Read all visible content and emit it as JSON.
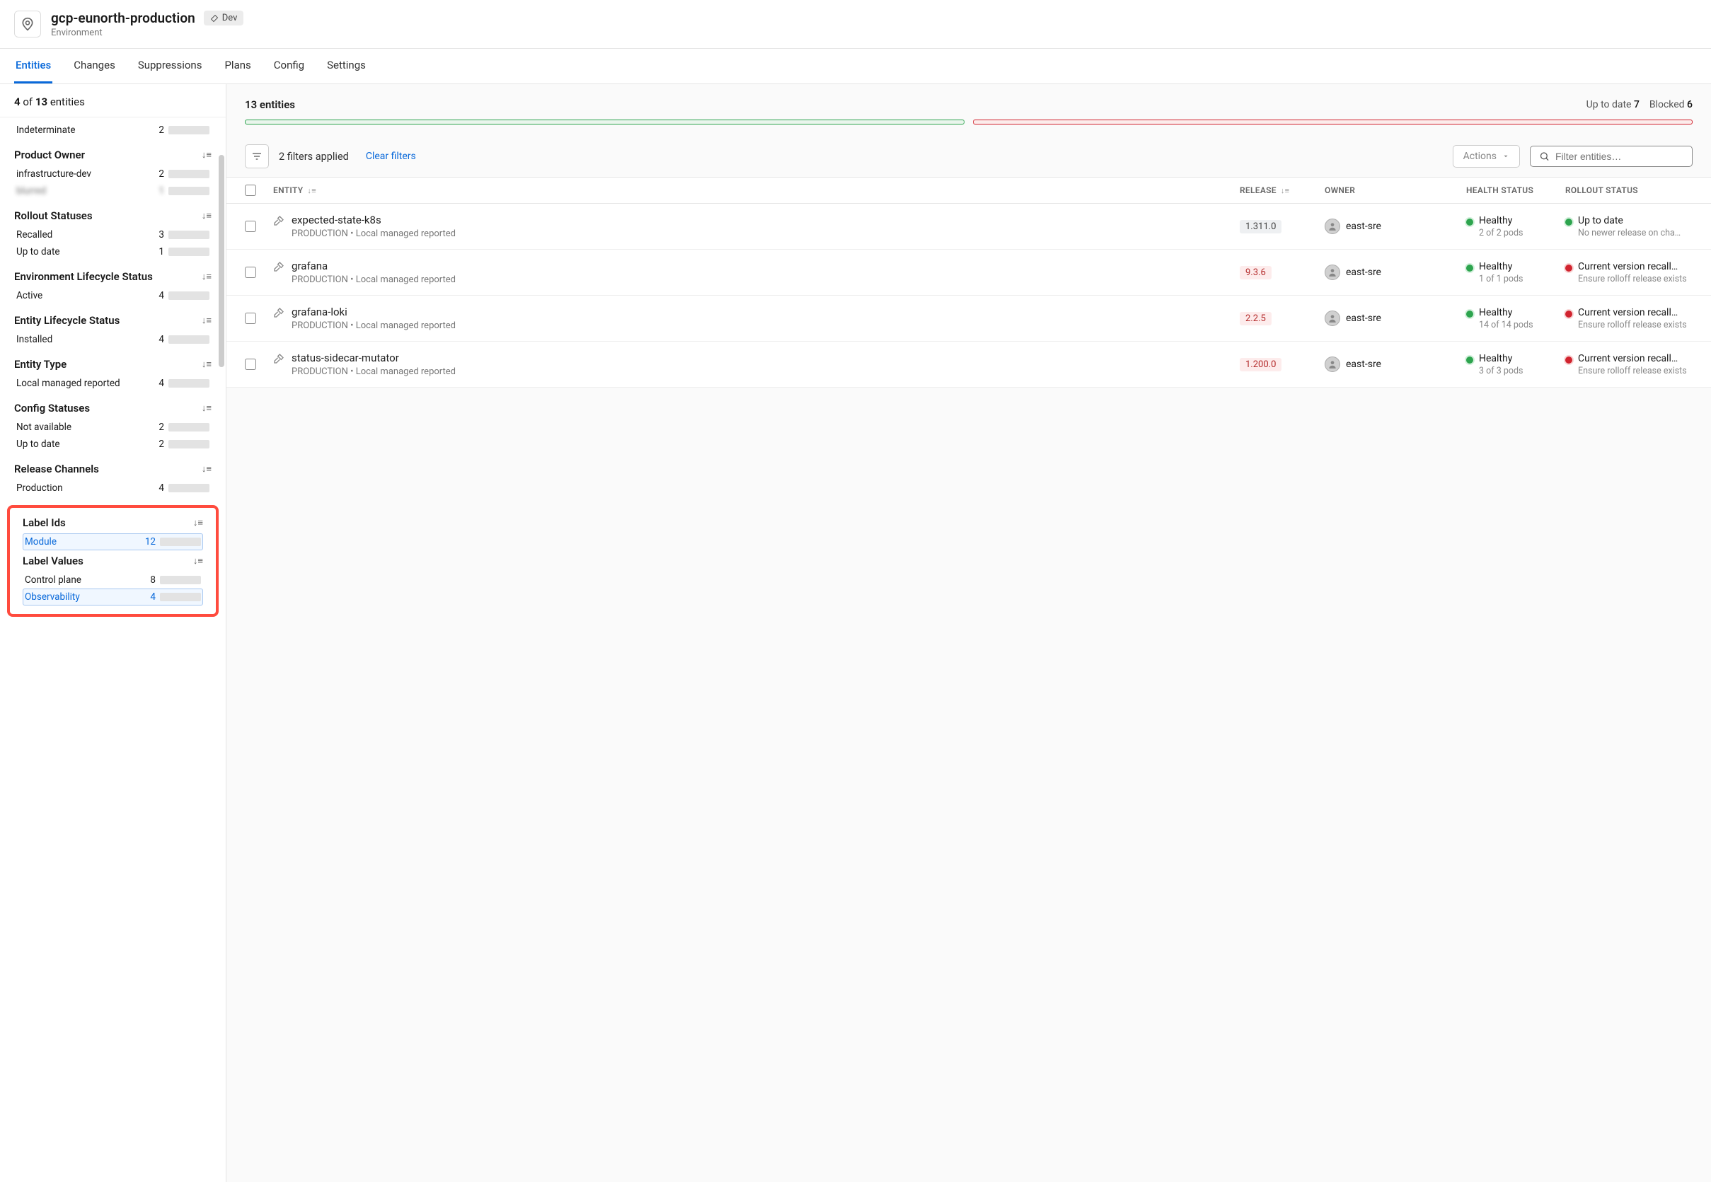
{
  "header": {
    "title": "gcp-eunorth-production",
    "subtitle": "Environment",
    "badge": "Dev"
  },
  "tabs": [
    "Entities",
    "Changes",
    "Suppressions",
    "Plans",
    "Config",
    "Settings"
  ],
  "active_tab": 0,
  "sidebar": {
    "count_shown": "4",
    "count_of": "of",
    "count_total": "13",
    "count_label": "entities",
    "top_row": {
      "label": "Indeterminate",
      "count": 2,
      "pct": 100
    },
    "facets": [
      {
        "title": "Product Owner",
        "rows": [
          {
            "label": "infrastructure-dev",
            "count": 2,
            "pct": 100
          },
          {
            "label": "blurred",
            "count": 1,
            "pct": 55,
            "blur": true
          }
        ]
      },
      {
        "title": "Rollout Statuses",
        "rows": [
          {
            "label": "Recalled",
            "count": 3,
            "pct": 100
          },
          {
            "label": "Up to date",
            "count": 1,
            "pct": 33
          }
        ]
      },
      {
        "title": "Environment Lifecycle Status",
        "rows": [
          {
            "label": "Active",
            "count": 4,
            "pct": 100
          }
        ]
      },
      {
        "title": "Entity Lifecycle Status",
        "rows": [
          {
            "label": "Installed",
            "count": 4,
            "pct": 100
          }
        ]
      },
      {
        "title": "Entity Type",
        "rows": [
          {
            "label": "Local managed reported",
            "count": 4,
            "pct": 100
          }
        ]
      },
      {
        "title": "Config Statuses",
        "rows": [
          {
            "label": "Not available",
            "count": 2,
            "pct": 100
          },
          {
            "label": "Up to date",
            "count": 2,
            "pct": 100
          }
        ]
      },
      {
        "title": "Release Channels",
        "rows": [
          {
            "label": "Production",
            "count": 4,
            "pct": 100
          }
        ]
      }
    ],
    "highlighted": [
      {
        "title": "Label Ids",
        "rows": [
          {
            "label": "Module",
            "count": 12,
            "pct": 100,
            "selected": true
          }
        ]
      },
      {
        "title": "Label Values",
        "rows": [
          {
            "label": "Control plane",
            "count": 8,
            "pct": 100
          },
          {
            "label": "Observability",
            "count": 4,
            "pct": 50,
            "selected": true
          }
        ]
      }
    ]
  },
  "summary": {
    "title": "13 entities",
    "uptodate_label": "Up to date",
    "uptodate_count": "7",
    "blocked_label": "Blocked",
    "blocked_count": "6"
  },
  "toolbar": {
    "filters_text": "2 filters applied",
    "clear_text": "Clear filters",
    "actions_label": "Actions",
    "search_placeholder": "Filter entities…"
  },
  "columns": {
    "entity": "ENTITY",
    "release": "RELEASE",
    "owner": "OWNER",
    "health": "HEALTH STATUS",
    "rollout": "ROLLOUT STATUS"
  },
  "rows": [
    {
      "name": "expected-state-k8s",
      "meta": "PRODUCTION • Local managed reported",
      "release": "1.311.0",
      "release_warn": false,
      "owner": "east-sre",
      "health": "Healthy",
      "health_sub": "2 of 2 pods",
      "rollout": "Up to date",
      "rollout_sub": "No newer release on cha…",
      "rollout_color": "green"
    },
    {
      "name": "grafana",
      "meta": "PRODUCTION • Local managed reported",
      "release": "9.3.6",
      "release_warn": true,
      "owner": "east-sre",
      "health": "Healthy",
      "health_sub": "1 of 1 pods",
      "rollout": "Current version recall…",
      "rollout_sub": "Ensure rolloff release exists",
      "rollout_color": "red"
    },
    {
      "name": "grafana-loki",
      "meta": "PRODUCTION • Local managed reported",
      "release": "2.2.5",
      "release_warn": true,
      "owner": "east-sre",
      "health": "Healthy",
      "health_sub": "14 of 14 pods",
      "rollout": "Current version recall…",
      "rollout_sub": "Ensure rolloff release exists",
      "rollout_color": "red"
    },
    {
      "name": "status-sidecar-mutator",
      "meta": "PRODUCTION • Local managed reported",
      "release": "1.200.0",
      "release_warn": true,
      "owner": "east-sre",
      "health": "Healthy",
      "health_sub": "3 of 3 pods",
      "rollout": "Current version recall…",
      "rollout_sub": "Ensure rolloff release exists",
      "rollout_color": "red"
    }
  ]
}
